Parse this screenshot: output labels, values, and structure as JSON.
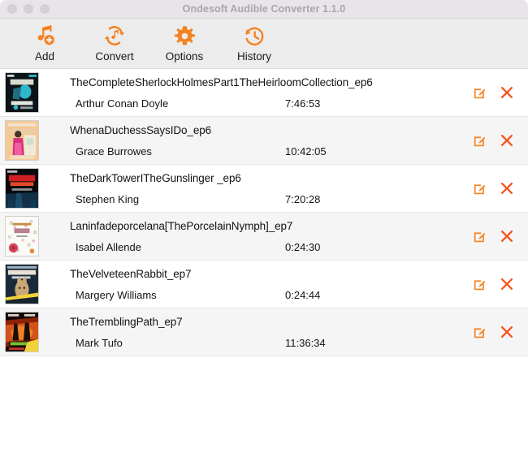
{
  "window": {
    "title": "Ondesoft Audible Converter 1.1.0",
    "traffic_lights": [
      "close-button",
      "minimize-button",
      "zoom-button"
    ]
  },
  "theme": {
    "accent": "#f58220",
    "titlebar_bg": "#e8e4e9",
    "toolbar_bg": "#ececec",
    "row_alt_bg": "#f5f5f5",
    "title_text": "#a9a5ae",
    "body_text": "#131313"
  },
  "toolbar": {
    "items": [
      {
        "label": "Add",
        "icon": "music-note-add-icon"
      },
      {
        "label": "Convert",
        "icon": "convert-refresh-icon"
      },
      {
        "label": "Options",
        "icon": "gear-icon"
      },
      {
        "label": "History",
        "icon": "clock-history-icon"
      }
    ]
  },
  "list": {
    "row_actions": {
      "edit": "edit-icon",
      "delete": "delete-icon"
    },
    "rows": [
      {
        "title": "TheCompleteSherlockHolmesPart1TheHeirloomCollection_ep6",
        "author": "Arthur Conan Doyle",
        "duration": "7:46:53",
        "cover": "sherlock-holmes-cover"
      },
      {
        "title": "WhenaDuchessSaysIDo_ep6",
        "author": "Grace Burrowes",
        "duration": "10:42:05",
        "cover": "when-a-duchess-says-i-do-cover"
      },
      {
        "title": "TheDarkTowerITheGunslinger _ep6",
        "author": "Stephen King",
        "duration": "7:20:28",
        "cover": "dark-tower-gunslinger-cover"
      },
      {
        "title": "Laninfadeporcelana[ThePorcelainNymph]_ep7",
        "author": "Isabel Allende",
        "duration": "0:24:30",
        "cover": "porcelain-nymph-cover"
      },
      {
        "title": "TheVelveteenRabbit_ep7",
        "author": "Margery Williams",
        "duration": "0:24:44",
        "cover": "velveteen-rabbit-cover"
      },
      {
        "title": "TheTremblingPath_ep7",
        "author": "Mark Tufo",
        "duration": "11:36:34",
        "cover": "trembling-path-cover"
      }
    ]
  }
}
